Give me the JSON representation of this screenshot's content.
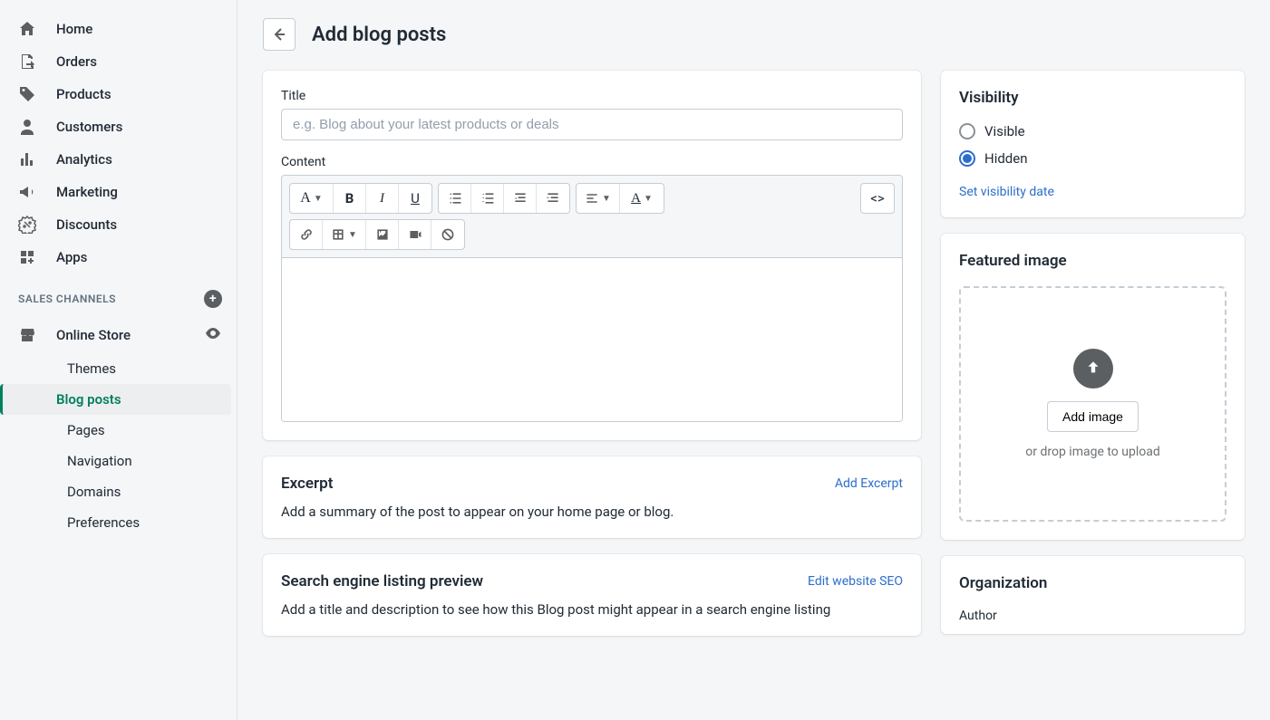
{
  "sidebar": {
    "items": [
      {
        "label": "Home",
        "icon": "home"
      },
      {
        "label": "Orders",
        "icon": "orders"
      },
      {
        "label": "Products",
        "icon": "products"
      },
      {
        "label": "Customers",
        "icon": "customers"
      },
      {
        "label": "Analytics",
        "icon": "analytics"
      },
      {
        "label": "Marketing",
        "icon": "marketing"
      },
      {
        "label": "Discounts",
        "icon": "discounts"
      },
      {
        "label": "Apps",
        "icon": "apps"
      }
    ],
    "channels_heading": "SALES CHANNELS",
    "online_store": "Online Store",
    "sub": [
      {
        "label": "Themes",
        "active": false
      },
      {
        "label": "Blog posts",
        "active": true
      },
      {
        "label": "Pages",
        "active": false
      },
      {
        "label": "Navigation",
        "active": false
      },
      {
        "label": "Domains",
        "active": false
      },
      {
        "label": "Preferences",
        "active": false
      }
    ]
  },
  "page": {
    "title": "Add blog posts"
  },
  "form": {
    "title_label": "Title",
    "title_placeholder": "e.g. Blog about your latest products or deals",
    "content_label": "Content"
  },
  "excerpt": {
    "title": "Excerpt",
    "action": "Add Excerpt",
    "desc": "Add a summary of the post to appear on your home page or blog."
  },
  "seo": {
    "title": "Search engine listing preview",
    "action": "Edit website SEO",
    "desc": "Add a title and description to see how this Blog post might appear in a search engine listing"
  },
  "visibility": {
    "title": "Visibility",
    "visible_label": "Visible",
    "hidden_label": "Hidden",
    "selected": "hidden",
    "link": "Set visibility date"
  },
  "featured": {
    "title": "Featured image",
    "add_btn": "Add image",
    "hint": "or drop image to upload"
  },
  "org": {
    "title": "Organization",
    "author_label": "Author"
  }
}
